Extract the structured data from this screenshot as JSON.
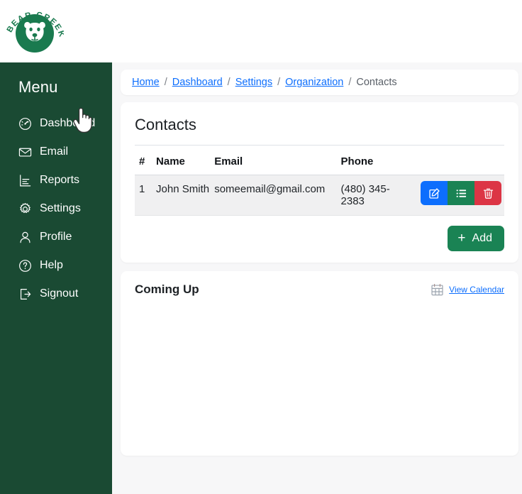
{
  "brand": {
    "logo_name": "bear-creek-logo",
    "logo_text_top": "BEAR",
    "logo_text_bottom": "CREEK",
    "logo_color": "#1a7a4f"
  },
  "sidebar": {
    "title": "Menu",
    "background": "#1a4a33",
    "items": [
      {
        "label": "Dashboard",
        "icon": "speedometer-icon"
      },
      {
        "label": "Email",
        "icon": "envelope-icon"
      },
      {
        "label": "Reports",
        "icon": "bar-chart-icon"
      },
      {
        "label": "Settings",
        "icon": "gear-icon"
      },
      {
        "label": "Profile",
        "icon": "person-icon"
      },
      {
        "label": "Help",
        "icon": "question-circle-icon"
      },
      {
        "label": "Signout",
        "icon": "box-arrow-right-icon"
      }
    ]
  },
  "breadcrumb": {
    "separator": "/",
    "items": [
      {
        "label": "Home",
        "is_link": true
      },
      {
        "label": "Dashboard",
        "is_link": true
      },
      {
        "label": "Settings",
        "is_link": true
      },
      {
        "label": "Organization",
        "is_link": true
      },
      {
        "label": "Contacts",
        "is_link": false
      }
    ]
  },
  "contacts": {
    "title": "Contacts",
    "columns": [
      "#",
      "Name",
      "Email",
      "Phone",
      ""
    ],
    "rows": [
      {
        "num": "1",
        "name": "John Smith",
        "email": "someemail@gmail.com",
        "phone": "(480) 345-2383",
        "actions": [
          {
            "name": "edit-contact-button",
            "icon": "pencil-square-icon",
            "color": "#0d6efd"
          },
          {
            "name": "view-list-button",
            "icon": "list-ul-icon",
            "color": "#1a8354"
          },
          {
            "name": "delete-contact-button",
            "icon": "trash-icon",
            "color": "#dc3545"
          }
        ]
      }
    ],
    "add_button_label": "Add",
    "add_button_icon": "plus-icon",
    "add_button_color": "#1a8354"
  },
  "coming_up": {
    "title": "Coming Up",
    "calendar_icon": "calendar-grid-icon",
    "calendar_link_label": "View Calendar"
  },
  "cursor": {
    "type": "pointing-hand-cursor"
  }
}
